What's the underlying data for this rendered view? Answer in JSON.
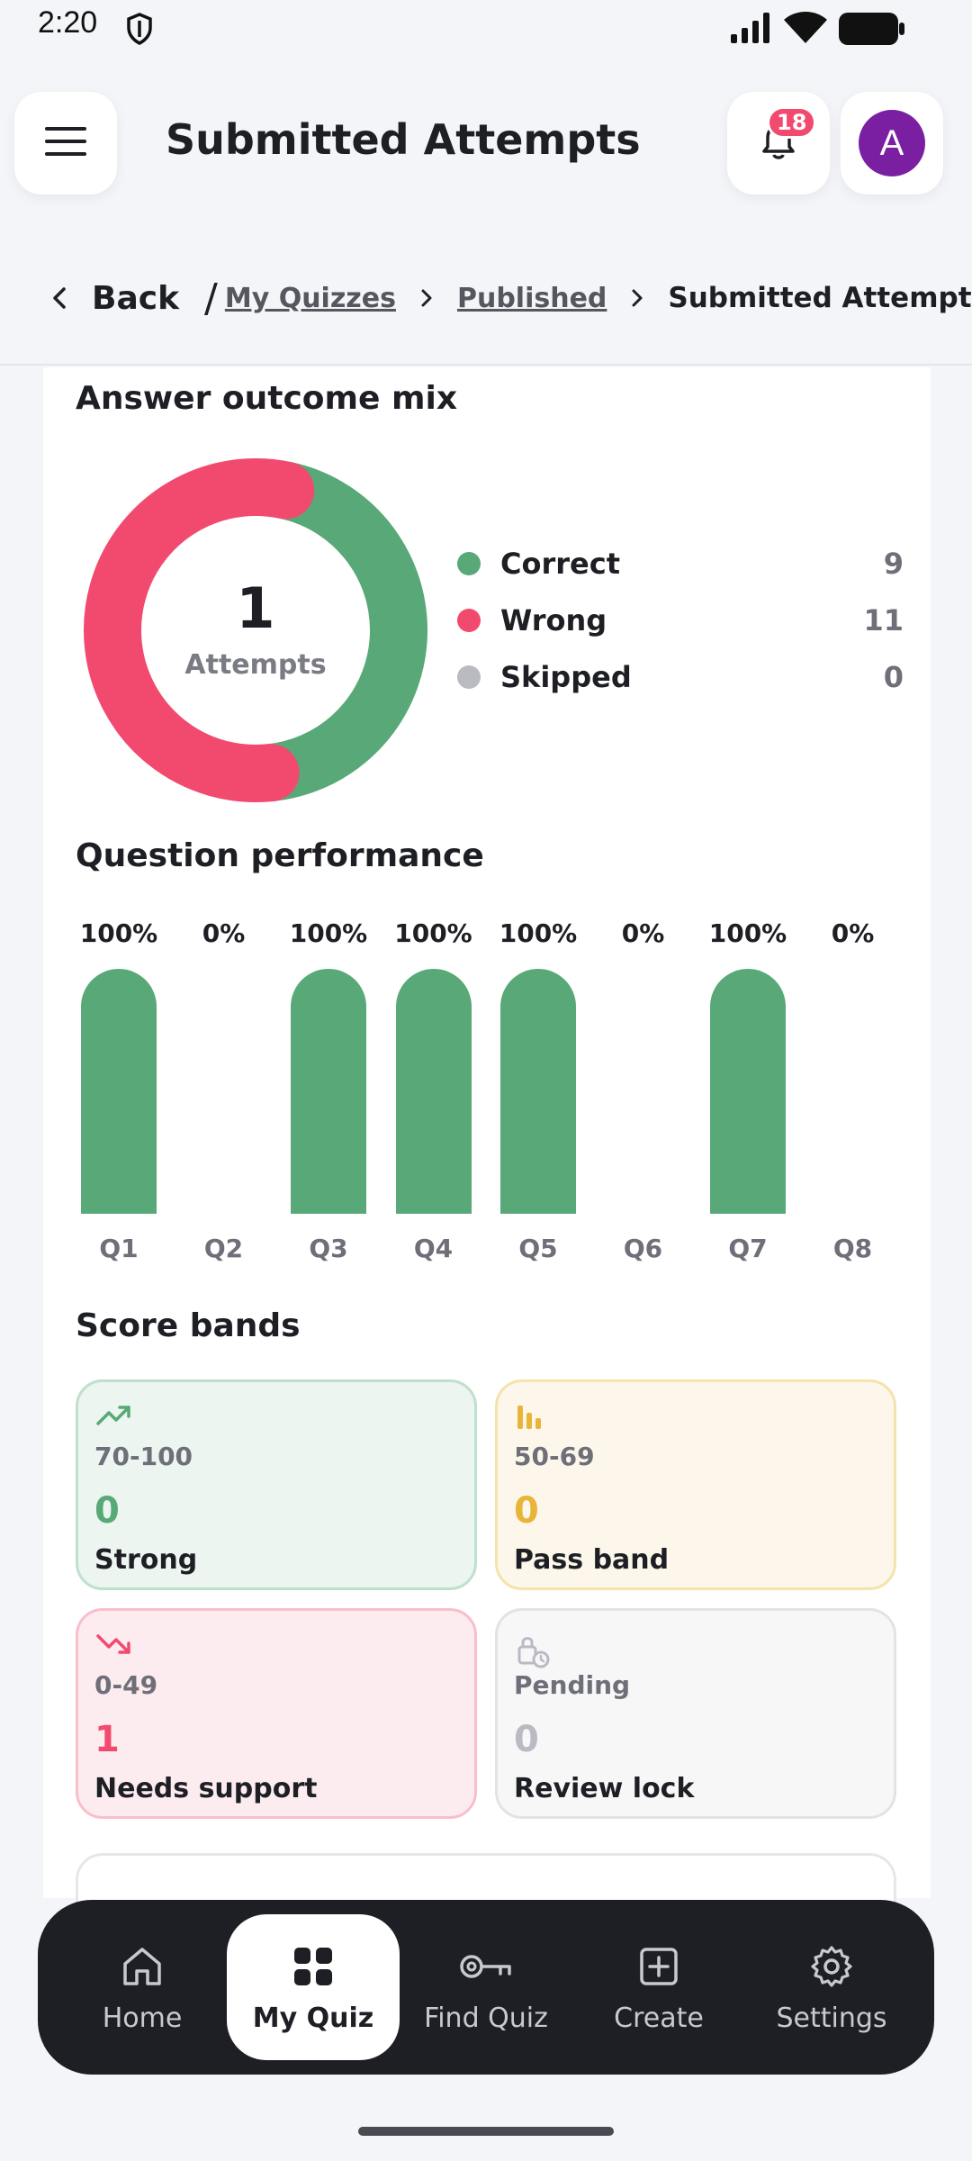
{
  "status_bar": {
    "time": "2:20"
  },
  "header": {
    "title": "Submitted Attempts",
    "notification_count": "18",
    "avatar_initial": "A"
  },
  "breadcrumb": {
    "back_label": "Back",
    "separator": "/",
    "items": [
      "My Quizzes",
      "Published"
    ],
    "current": "Submitted Attempts"
  },
  "outcome": {
    "title": "Answer outcome mix",
    "attempts_count": "1",
    "attempts_label": "Attempts",
    "legend": [
      {
        "label": "Correct",
        "value": "9",
        "color": "#58a977"
      },
      {
        "label": "Wrong",
        "value": "11",
        "color": "#f24a6e"
      },
      {
        "label": "Skipped",
        "value": "0",
        "color": "#b9bac2"
      }
    ]
  },
  "performance": {
    "title": "Question performance",
    "questions": [
      {
        "label": "Q1",
        "pct": "100%"
      },
      {
        "label": "Q2",
        "pct": "0%"
      },
      {
        "label": "Q3",
        "pct": "100%"
      },
      {
        "label": "Q4",
        "pct": "100%"
      },
      {
        "label": "Q5",
        "pct": "100%"
      },
      {
        "label": "Q6",
        "pct": "0%"
      },
      {
        "label": "Q7",
        "pct": "100%"
      },
      {
        "label": "Q8",
        "pct": "0%"
      }
    ]
  },
  "chart_data": [
    {
      "type": "pie",
      "title": "Answer outcome mix",
      "categories": [
        "Correct",
        "Wrong",
        "Skipped"
      ],
      "values": [
        9,
        11,
        0
      ],
      "colors": [
        "#58a977",
        "#f24a6e",
        "#b9bac2"
      ]
    },
    {
      "type": "bar",
      "title": "Question performance",
      "categories": [
        "Q1",
        "Q2",
        "Q3",
        "Q4",
        "Q5",
        "Q6",
        "Q7",
        "Q8"
      ],
      "values": [
        100,
        0,
        100,
        100,
        100,
        0,
        100,
        0
      ],
      "ylim": [
        0,
        100
      ],
      "color": "#58a977"
    }
  ],
  "score_bands": {
    "title": "Score bands",
    "bands": [
      {
        "range": "70-100",
        "count": "0",
        "name": "Strong",
        "icon": "trending-up-icon",
        "color": "#58a977"
      },
      {
        "range": "50-69",
        "count": "0",
        "name": "Pass band",
        "icon": "bar-chart-icon",
        "color": "#e8b53a"
      },
      {
        "range": "0-49",
        "count": "1",
        "name": "Needs support",
        "icon": "trending-down-icon",
        "color": "#f24a6e"
      },
      {
        "range": "Pending",
        "count": "0",
        "name": "Review lock",
        "icon": "lock-clock-icon",
        "color": "#b9bac2"
      }
    ]
  },
  "nav": {
    "items": [
      {
        "label": "Home",
        "icon": "home-icon"
      },
      {
        "label": "My Quiz",
        "icon": "grid-icon",
        "active": true
      },
      {
        "label": "Find Quiz",
        "icon": "key-icon"
      },
      {
        "label": "Create",
        "icon": "plus-square-icon"
      },
      {
        "label": "Settings",
        "icon": "gear-icon"
      }
    ]
  }
}
